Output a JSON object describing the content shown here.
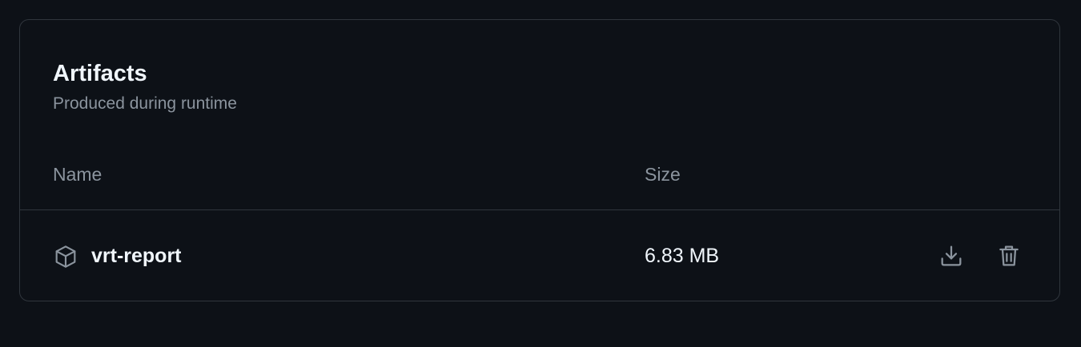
{
  "artifacts": {
    "title": "Artifacts",
    "subtitle": "Produced during runtime",
    "columns": {
      "name": "Name",
      "size": "Size"
    },
    "rows": [
      {
        "name": "vrt-report",
        "size": "6.83 MB",
        "icon": "package-icon"
      }
    ],
    "actions": [
      "download-icon",
      "trash-icon"
    ]
  },
  "colors": {
    "background": "#0d1117",
    "border": "#30363d",
    "text_primary": "#f0f6fc",
    "text_muted": "#8b949e",
    "icon": "#8b949e"
  }
}
